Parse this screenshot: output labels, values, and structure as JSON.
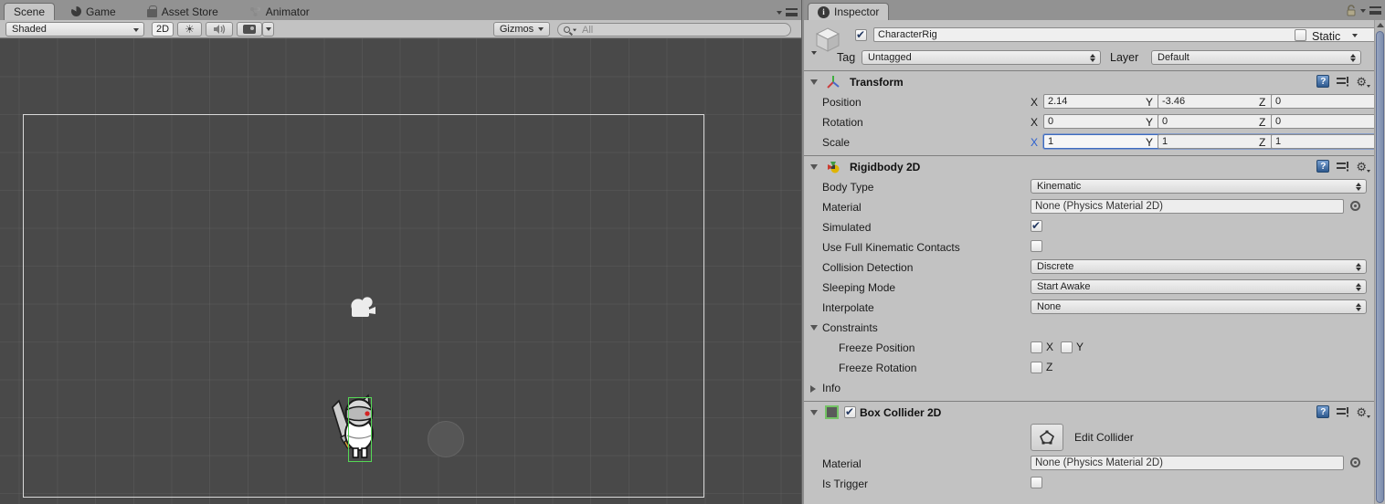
{
  "scene_panel": {
    "tabs": [
      {
        "label": "Scene",
        "active": true
      },
      {
        "label": "Game",
        "active": false
      },
      {
        "label": "Asset Store",
        "active": false
      },
      {
        "label": "Animator",
        "active": false
      }
    ],
    "toolbar": {
      "shading_mode": "Shaded",
      "mode_2d_label": "2D",
      "gizmos_label": "Gizmos",
      "search_placeholder": "All"
    }
  },
  "inspector": {
    "tab_label": "Inspector",
    "header": {
      "active_checked": true,
      "name": "CharacterRig",
      "static_label": "Static",
      "static_checked": false,
      "tag_label": "Tag",
      "tag_value": "Untagged",
      "layer_label": "Layer",
      "layer_value": "Default"
    },
    "transform": {
      "title": "Transform",
      "position_label": "Position",
      "rotation_label": "Rotation",
      "scale_label": "Scale",
      "x_label": "X",
      "y_label": "Y",
      "z_label": "Z",
      "position": {
        "x": "2.14",
        "y": "-3.46",
        "z": "0"
      },
      "rotation": {
        "x": "0",
        "y": "0",
        "z": "0"
      },
      "scale": {
        "x": "1",
        "y": "1",
        "z": "1"
      },
      "focused_field": "scale.x"
    },
    "rigidbody2d": {
      "title": "Rigidbody 2D",
      "body_type_label": "Body Type",
      "body_type_value": "Kinematic",
      "material_label": "Material",
      "material_value": "None (Physics Material 2D)",
      "simulated_label": "Simulated",
      "simulated_checked": true,
      "kinematic_contacts_label": "Use Full Kinematic Contacts",
      "kinematic_contacts_checked": false,
      "collision_detection_label": "Collision Detection",
      "collision_detection_value": "Discrete",
      "sleeping_mode_label": "Sleeping Mode",
      "sleeping_mode_value": "Start Awake",
      "interpolate_label": "Interpolate",
      "interpolate_value": "None",
      "constraints_label": "Constraints",
      "freeze_position_label": "Freeze Position",
      "freeze_rotation_label": "Freeze Rotation",
      "freeze_x_label": "X",
      "freeze_y_label": "Y",
      "freeze_z_label": "Z",
      "freeze_position_x": false,
      "freeze_position_y": false,
      "freeze_rotation_z": false,
      "info_label": "Info"
    },
    "boxcollider2d": {
      "title": "Box Collider 2D",
      "enabled_checked": true,
      "edit_collider_label": "Edit Collider",
      "material_label": "Material",
      "material_value": "None (Physics Material 2D)",
      "is_trigger_label": "Is Trigger",
      "is_trigger_checked": false
    }
  },
  "colors": {
    "scene_background": "#494949",
    "panel_background": "#c2c2c2",
    "collider_green": "#55d855",
    "focus_blue": "#3d6bbf",
    "checkmark_navy": "#253a63",
    "scrollbar_thumb": "#8494b0",
    "camera_bounds_white": "#d9d9d9"
  }
}
